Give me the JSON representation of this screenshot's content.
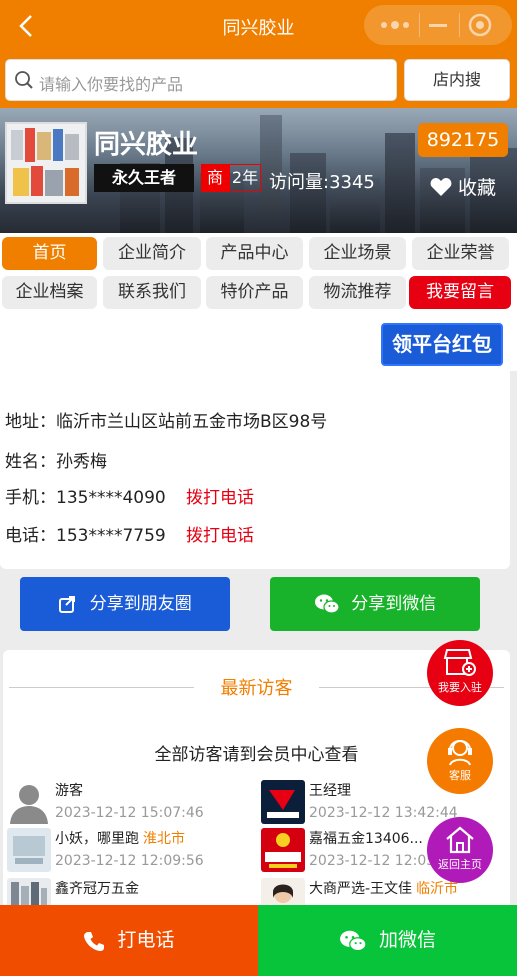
{
  "header": {
    "title": "同兴胶业"
  },
  "search": {
    "placeholder": "请输入你要找的产品",
    "button": "店内搜"
  },
  "company": {
    "name": "同兴胶业",
    "rank_badge": "永久王者",
    "merchant_badge": "商",
    "years": "2年",
    "visits": "访问量:3345",
    "code": "892175",
    "favorite": "收藏"
  },
  "tabs": [
    {
      "label": "首页"
    },
    {
      "label": "企业简介"
    },
    {
      "label": "产品中心"
    },
    {
      "label": "企业场景"
    },
    {
      "label": "企业荣誉"
    },
    {
      "label": "企业档案"
    },
    {
      "label": "联系我们"
    },
    {
      "label": "特价产品"
    },
    {
      "label": "物流推荐"
    },
    {
      "label": "我要留言"
    }
  ],
  "redpack": "领平台红包",
  "contact": {
    "address": "地址：临沂市兰山区站前五金市场B区98号",
    "name": "姓名：孙秀梅",
    "mobile": "手机：135****4090",
    "phone": "电话：153****7759",
    "call": "拨打电话"
  },
  "share": {
    "moments": "分享到朋友圈",
    "wechat": "分享到微信"
  },
  "visitors": {
    "title": "最新访客",
    "note": "全部访客请到会员中心查看",
    "items": [
      {
        "name": "游客",
        "city": "",
        "time": "2023-12-12 15:07:46"
      },
      {
        "name": "王经理",
        "city": "",
        "time": "2023-12-12 13:42:44"
      },
      {
        "name": "小妖，哪里跑",
        "city": "淮北市",
        "time": "2023-12-12 12:09:56"
      },
      {
        "name": "嘉福五金13406...",
        "city": "",
        "time": "2023-12-12 12:05:"
      },
      {
        "name": "鑫齐冠万五金",
        "city": "",
        "time": ""
      },
      {
        "name": "大商严选-王文佳",
        "city": "临沂市",
        "time": ""
      }
    ]
  },
  "floating": {
    "join": "我要入驻",
    "service": "客服",
    "home": "返回主页"
  },
  "bottom": {
    "call": "打电话",
    "wechat": "加微信"
  },
  "colors": {
    "brand": "#f07f00",
    "red": "#e60012",
    "blue": "#1a5bd8",
    "green": "#18b32a"
  }
}
